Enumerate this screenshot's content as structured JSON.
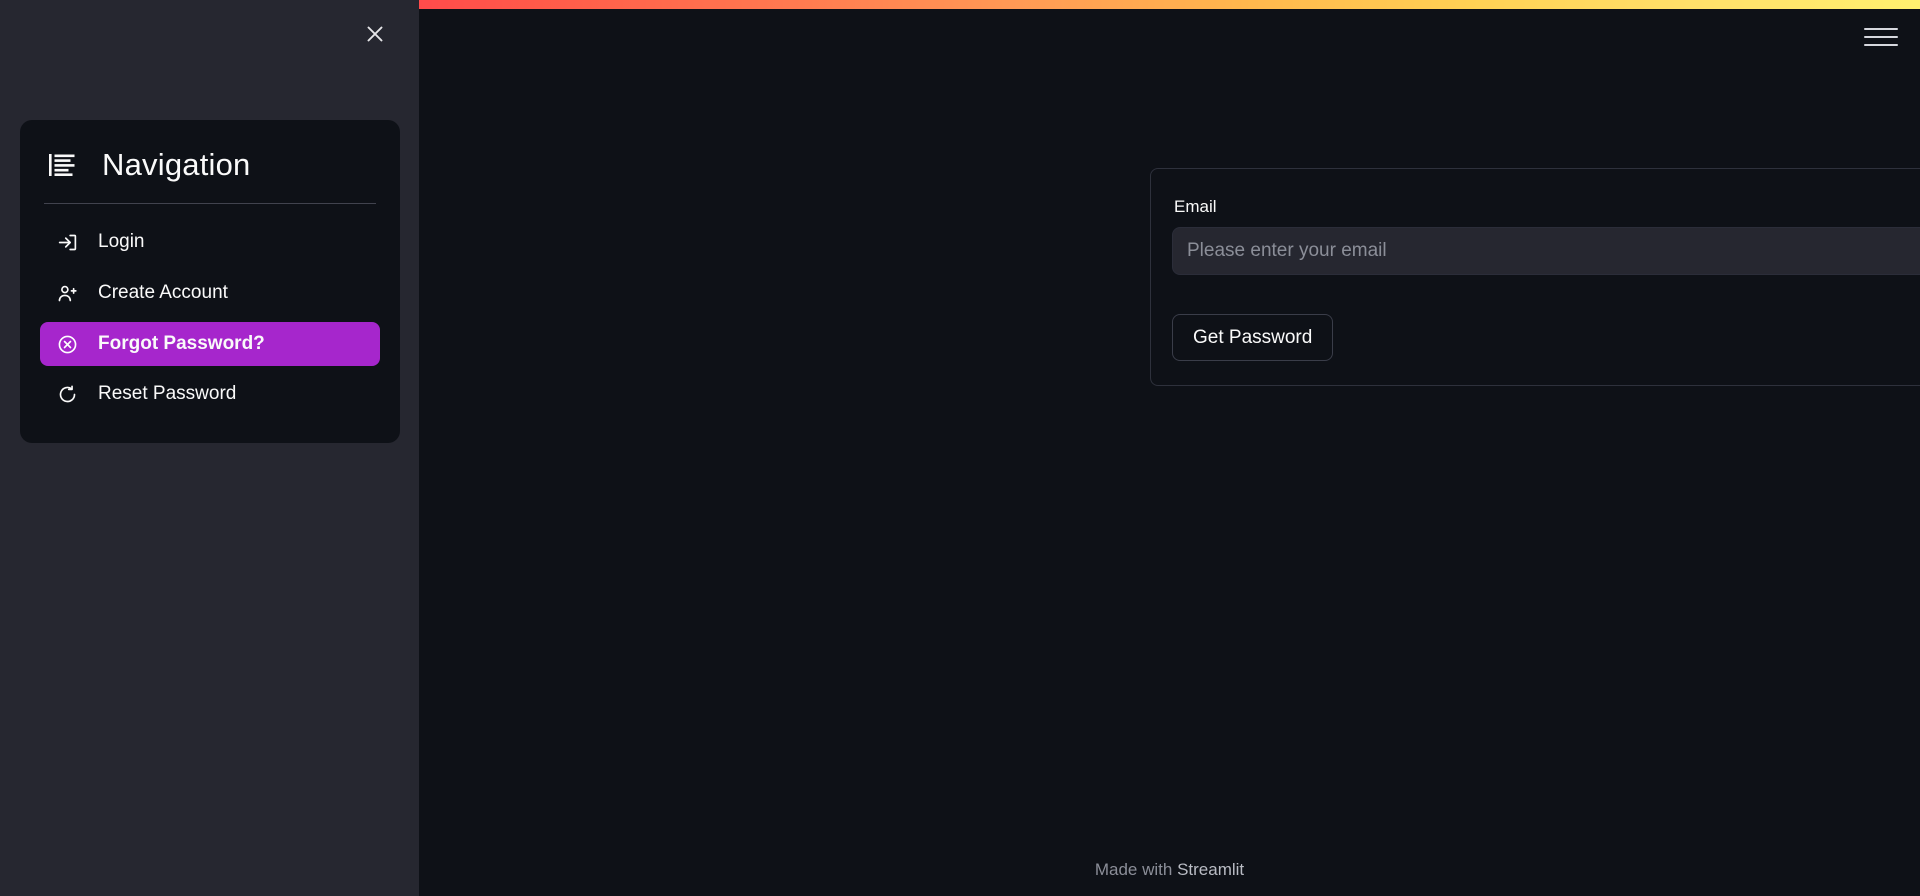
{
  "app": {
    "background_color": "#0e1117",
    "sidebar_color": "#262730",
    "accent_color": "#a626cc",
    "gradient_start": "#ff4b4b",
    "gradient_end": "#fff06f"
  },
  "sidebar": {
    "close_label": "×",
    "nav": {
      "title": "Navigation",
      "icon": "list-menu-icon",
      "items": [
        {
          "label": "Login",
          "icon": "login-arrow-icon",
          "active": false
        },
        {
          "label": "Create Account",
          "icon": "user-plus-icon",
          "active": false
        },
        {
          "label": "Forgot Password?",
          "icon": "circle-x-icon",
          "active": true
        },
        {
          "label": "Reset Password",
          "icon": "rotate-ccw-icon",
          "active": false
        }
      ]
    }
  },
  "main": {
    "menu_icon": "hamburger-menu-icon",
    "form": {
      "email_label": "Email",
      "email_value": "",
      "email_placeholder": "Please enter your email",
      "submit_label": "Get Password"
    },
    "footer": {
      "prefix": "Made with ",
      "brand": "Streamlit"
    }
  }
}
